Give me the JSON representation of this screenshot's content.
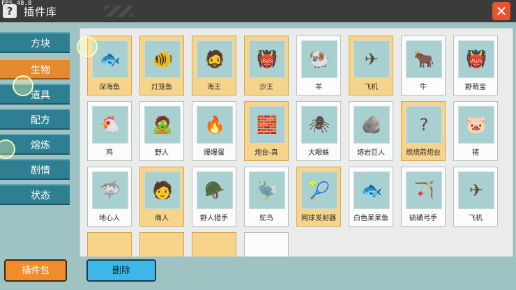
{
  "header": {
    "fps": "FPS 48.8",
    "title": "插件库",
    "help_icon": "?",
    "close_icon": "✕"
  },
  "sidebar": {
    "items": [
      {
        "label": "方块"
      },
      {
        "label": "生物"
      },
      {
        "label": "道具"
      },
      {
        "label": "配方"
      },
      {
        "label": "熔炼"
      },
      {
        "label": "剧情"
      },
      {
        "label": "状态"
      }
    ],
    "plugin_pack": "插件包"
  },
  "tiles": [
    {
      "label": "深海鱼",
      "icon": "🐟"
    },
    {
      "label": "灯笼鱼",
      "icon": "🐠"
    },
    {
      "label": "海王",
      "icon": "🧔"
    },
    {
      "label": "沙王",
      "icon": "👹"
    },
    {
      "label": "羊",
      "icon": "🐏"
    },
    {
      "label": "飞机",
      "icon": "✈"
    },
    {
      "label": "牛",
      "icon": "🐂"
    },
    {
      "label": "野萌宝",
      "icon": "👹"
    },
    {
      "label": "鸡",
      "icon": "🐔"
    },
    {
      "label": "野人",
      "icon": "🧟"
    },
    {
      "label": "爆爆蛋",
      "icon": "🔥"
    },
    {
      "label": "炮台-真",
      "icon": "🧱"
    },
    {
      "label": "大眼蛛",
      "icon": "🕷"
    },
    {
      "label": "熔岩巨人",
      "icon": "🪨"
    },
    {
      "label": "燃烧箭炮台",
      "icon": "?"
    },
    {
      "label": "猪",
      "icon": "🐷"
    },
    {
      "label": "地心人",
      "icon": "🦈"
    },
    {
      "label": "商人",
      "icon": "🧑"
    },
    {
      "label": "野人猎手",
      "icon": "🪖"
    },
    {
      "label": "鸵鸟",
      "icon": "🦤"
    },
    {
      "label": "网球发射器",
      "icon": "🎾"
    },
    {
      "label": "白色呆呆鱼",
      "icon": "🐟"
    },
    {
      "label": "硫磺弓手",
      "icon": "🏹"
    },
    {
      "label": "飞机",
      "icon": "✈"
    }
  ],
  "footer": {
    "delete": "删除"
  }
}
